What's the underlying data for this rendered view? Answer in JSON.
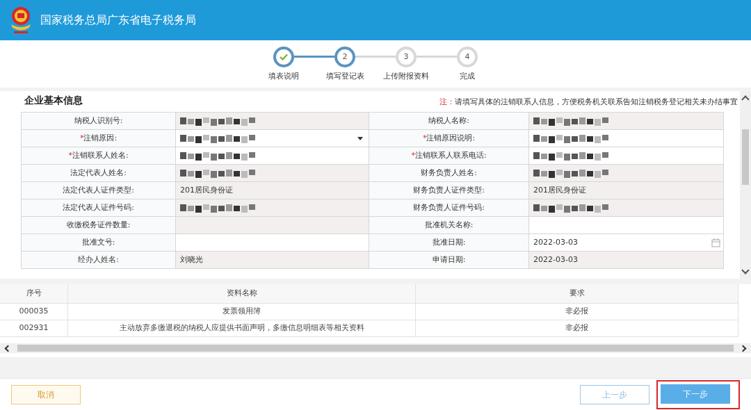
{
  "header": {
    "title": "国家税务总局广东省电子税务局"
  },
  "steps": [
    {
      "label": "填表说明",
      "done": true,
      "current": false
    },
    {
      "number": "2",
      "label": "填写登记表",
      "done": false,
      "current": true
    },
    {
      "number": "3",
      "label": "上传附报资料",
      "done": false,
      "current": false
    },
    {
      "number": "4",
      "label": "完成",
      "done": false,
      "current": false
    }
  ],
  "form": {
    "title": "企业基本信息",
    "note_mark": "注：",
    "note": "请填写具体的注销联系人信息，方便税务机关联系告知注销税务登记相关未办结事宜",
    "rows": [
      [
        {
          "label": "纳税人识别号:",
          "readonly": true,
          "kind": "redacted"
        },
        {
          "label": "纳税人名称:",
          "readonly": true,
          "kind": "redacted"
        }
      ],
      [
        {
          "mark": "*",
          "label": "注销原因:",
          "readonly": false,
          "kind": "select"
        },
        {
          "mark": "*",
          "label": "注销原因说明:",
          "readonly": false,
          "kind": "redacted"
        }
      ],
      [
        {
          "mark": "*",
          "label": "注销联系人姓名:",
          "readonly": false,
          "kind": "redacted"
        },
        {
          "mark": "*",
          "label": "注销联系人联系电话:",
          "readonly": false,
          "kind": "redacted"
        }
      ],
      [
        {
          "label": "法定代表人姓名:",
          "readonly": true,
          "kind": "redacted"
        },
        {
          "label": "财务负责人姓名:",
          "readonly": true,
          "kind": "redacted"
        }
      ],
      [
        {
          "label": "法定代表人证件类型:",
          "readonly": true,
          "kind": "text",
          "value": "201居民身份证"
        },
        {
          "label": "财务负责人证件类型:",
          "readonly": true,
          "kind": "text",
          "value": "201居民身份证"
        }
      ],
      [
        {
          "label": "法定代表人证件号码:",
          "readonly": true,
          "kind": "redacted"
        },
        {
          "label": "财务负责人证件号码:",
          "readonly": true,
          "kind": "redacted"
        }
      ],
      [
        {
          "label": "收缴税务证件数量:",
          "readonly": true,
          "kind": "text"
        },
        {
          "label": "批准机关名称:",
          "readonly": false,
          "kind": "text"
        }
      ],
      [
        {
          "label": "批准文号:",
          "readonly": false,
          "kind": "text"
        },
        {
          "label": "批准日期:",
          "readonly": false,
          "kind": "date",
          "value": "2022-03-03"
        }
      ],
      [
        {
          "label": "经办人姓名:",
          "readonly": true,
          "kind": "text",
          "value": "刘晓光"
        },
        {
          "label": "申请日期:",
          "readonly": true,
          "kind": "text",
          "value": "2022-03-03"
        }
      ]
    ]
  },
  "materials": {
    "columns": [
      "序号",
      "资料名称",
      "要求"
    ],
    "rows": [
      [
        "000035",
        "发票领用簿",
        "非必报"
      ],
      [
        "002931",
        "主动放弃多缴退税的纳税人应提供书面声明，多缴信息明细表等相关资料",
        "非必报"
      ]
    ]
  },
  "buttons": {
    "cancel": "取消",
    "prev": "上一步",
    "next": "下一步"
  }
}
